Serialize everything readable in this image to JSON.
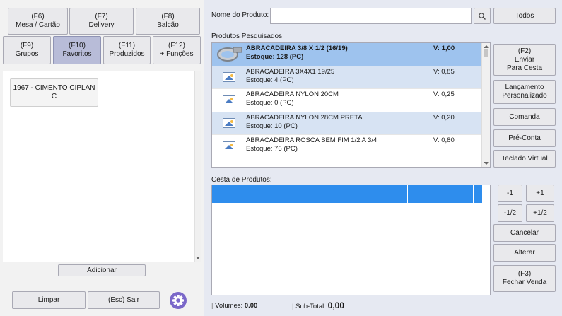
{
  "left": {
    "top_buttons": [
      {
        "key": "(F6)",
        "label": "Mesa / Cartão"
      },
      {
        "key": "(F7)",
        "label": "Delivery"
      },
      {
        "key": "(F8)",
        "label": "Balcão"
      },
      {
        "key": "(F9)",
        "label": "Grupos"
      },
      {
        "key": "(F10)",
        "label": "Favoritos"
      },
      {
        "key": "(F11)",
        "label": "Produzidos"
      },
      {
        "key": "(F12)",
        "label": "+ Funções"
      }
    ],
    "favorites": [
      "1967 - CIMENTO CIPLAN C"
    ],
    "add_label": "Adicionar",
    "clear_label": "Limpar",
    "exit_label": "(Esc) Sair",
    "settings_icon": "gear-icon"
  },
  "search": {
    "label": "Nome do Produto:",
    "value": "",
    "all_label": "Todos"
  },
  "results": {
    "label": "Produtos Pesquisados:",
    "items": [
      {
        "name": "ABRACADEIRA 3/8 X 1/2 (16/19)",
        "stock": "Estoque: 128 (PC)",
        "price": "V: 1,00",
        "thumb": "photo"
      },
      {
        "name": "ABRACADEIRA 3X4X1 19/25",
        "stock": "Estoque: 4 (PC)",
        "price": "V: 0,85",
        "thumb": "placeholder"
      },
      {
        "name": "ABRACADEIRA NYLON 20CM",
        "stock": "Estoque: 0 (PC)",
        "price": "V: 0,25",
        "thumb": "placeholder"
      },
      {
        "name": "ABRACADEIRA NYLON 28CM PRETA",
        "stock": "Estoque: 10 (PC)",
        "price": "V: 0,20",
        "thumb": "placeholder"
      },
      {
        "name": "ABRACADEIRA ROSCA SEM FIM 1/2 A 3/4",
        "stock": "Estoque: 76 (PC)",
        "price": "V: 0,80",
        "thumb": "placeholder"
      }
    ]
  },
  "side_buttons": {
    "send": {
      "key": "(F2)",
      "line1": "Enviar",
      "line2": "Para Cesta"
    },
    "custom": {
      "line1": "Lançamento",
      "line2": "Personalizado"
    },
    "comanda": "Comanda",
    "preconta": "Pré-Conta",
    "keyboard": "Teclado Virtual"
  },
  "basket": {
    "label": "Cesta de Produtos:"
  },
  "qty_buttons": {
    "minus1": "-1",
    "plus1": "+1",
    "minus_half": "-1/2",
    "plus_half": "+1/2"
  },
  "actions": {
    "cancel": "Cancelar",
    "alter": "Alterar",
    "close": {
      "key": "(F3)",
      "label": "Fechar Venda"
    }
  },
  "footer": {
    "volumes_label": "Volumes:",
    "volumes_value": "0.00",
    "subtotal_label": "Sub-Total:",
    "subtotal_value": "0,00"
  },
  "colors": {
    "accent": "#2e8ded",
    "selected_row": "#9ec3ee",
    "alt_row": "#d7e3f3",
    "active_tab": "#b8bcd8",
    "gear": "#7b68c9"
  }
}
